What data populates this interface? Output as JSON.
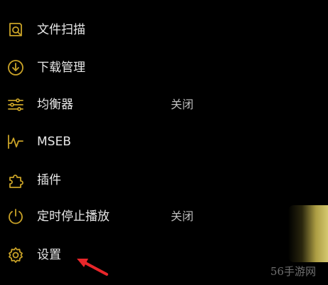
{
  "accent_color": "#c9a227",
  "menu": {
    "items": [
      {
        "label": "文件扫描",
        "value": "",
        "icon": "document-scan-icon"
      },
      {
        "label": "下载管理",
        "value": "",
        "icon": "download-circle-icon"
      },
      {
        "label": "均衡器",
        "value": "关闭",
        "icon": "equalizer-sliders-icon"
      },
      {
        "label": "MSEB",
        "value": "",
        "icon": "waveform-icon"
      },
      {
        "label": "插件",
        "value": "",
        "icon": "puzzle-plugin-icon"
      },
      {
        "label": "定时停止播放",
        "value": "关闭",
        "icon": "timer-power-icon"
      },
      {
        "label": "设置",
        "value": "",
        "icon": "gear-settings-icon"
      }
    ]
  },
  "watermark": "56手游网"
}
